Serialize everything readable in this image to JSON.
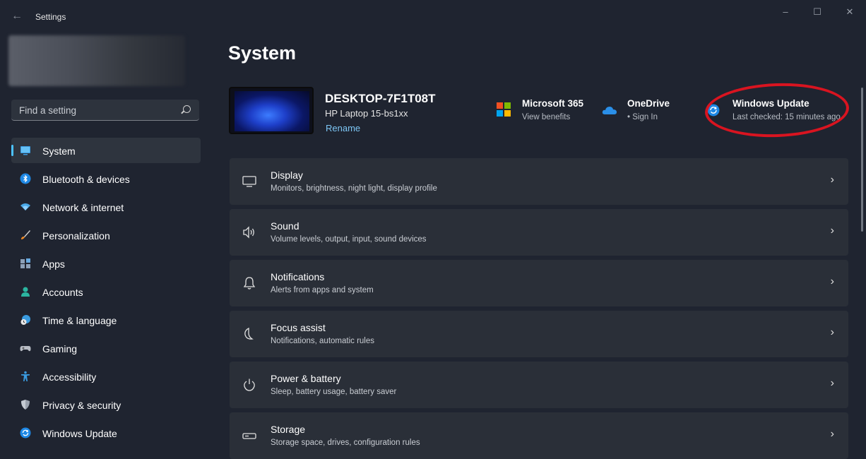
{
  "window": {
    "title": "Settings",
    "back_icon": "back-arrow-icon",
    "minimize": "–",
    "maximize": "☐",
    "close": "✕"
  },
  "search": {
    "placeholder": "Find a setting"
  },
  "nav": [
    {
      "label": "System",
      "icon": "monitor-icon",
      "active": true
    },
    {
      "label": "Bluetooth & devices",
      "icon": "bluetooth-icon"
    },
    {
      "label": "Network & internet",
      "icon": "wifi-icon"
    },
    {
      "label": "Personalization",
      "icon": "brush-icon"
    },
    {
      "label": "Apps",
      "icon": "apps-icon"
    },
    {
      "label": "Accounts",
      "icon": "person-icon"
    },
    {
      "label": "Time & language",
      "icon": "globe-clock-icon"
    },
    {
      "label": "Gaming",
      "icon": "gamepad-icon"
    },
    {
      "label": "Accessibility",
      "icon": "accessibility-icon"
    },
    {
      "label": "Privacy & security",
      "icon": "shield-icon"
    },
    {
      "label": "Windows Update",
      "icon": "sync-icon"
    }
  ],
  "page": {
    "title": "System"
  },
  "device": {
    "name": "DESKTOP-7F1T08T",
    "model": "HP Laptop 15-bs1xx",
    "rename": "Rename"
  },
  "quick": [
    {
      "title": "Microsoft 365",
      "sub": "View benefits",
      "icon": "microsoft-logo-icon"
    },
    {
      "title": "OneDrive",
      "sub": "• Sign In",
      "icon": "cloud-icon"
    },
    {
      "title": "Windows Update",
      "sub": "Last checked: 15 minutes ago",
      "icon": "sync-icon"
    }
  ],
  "cards": [
    {
      "title": "Display",
      "sub": "Monitors, brightness, night light, display profile",
      "icon": "display-icon"
    },
    {
      "title": "Sound",
      "sub": "Volume levels, output, input, sound devices",
      "icon": "speaker-icon"
    },
    {
      "title": "Notifications",
      "sub": "Alerts from apps and system",
      "icon": "bell-icon"
    },
    {
      "title": "Focus assist",
      "sub": "Notifications, automatic rules",
      "icon": "moon-icon"
    },
    {
      "title": "Power & battery",
      "sub": "Sleep, battery usage, battery saver",
      "icon": "power-icon"
    },
    {
      "title": "Storage",
      "sub": "Storage space, drives, configuration rules",
      "icon": "storage-icon"
    }
  ],
  "colors": {
    "accent": "#4cc2ff",
    "background": "#1f2430",
    "card": "#2a2f38",
    "highlight": "#d91420"
  }
}
